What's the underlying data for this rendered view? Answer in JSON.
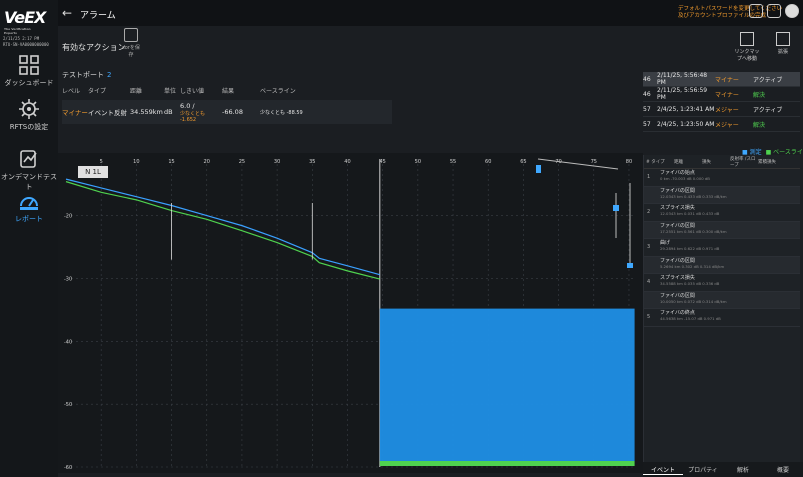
{
  "brand": {
    "logo_text": "VeEX",
    "logo_tagline": "The Verification Experts"
  },
  "device": {
    "line1": "2/11/25 2:17 PM",
    "line2": "RTU-SN-VA0000000000"
  },
  "sidebar": {
    "items": [
      {
        "label": "ダッシュボード"
      },
      {
        "label": "RFTSの設定"
      },
      {
        "label": "オンデマンドテスト"
      },
      {
        "label": "レポート"
      }
    ]
  },
  "header": {
    "title": "アラーム",
    "warning": "デフォルトパスワードを変更してください 及びアカウントプロファイルの完成"
  },
  "actions": {
    "label": "有効なアクション",
    "save_label": "sorを保存",
    "tools": [
      {
        "label": "リンクマップへ移動"
      },
      {
        "label": "拡張"
      }
    ]
  },
  "test_port": {
    "label": "テストポート",
    "number": "2",
    "columns": [
      "レベル",
      "タイプ",
      "距離",
      "単位",
      "しきい値",
      "結果",
      "ベースライン"
    ],
    "row": {
      "level": "マイナー",
      "type": "イベント反射",
      "distance": "34.559km",
      "unit": "dB",
      "threshold_prefix": "6.0 /",
      "threshold_value": "少なくとも -1.652",
      "result": "-66.08",
      "baseline": "少なくとも -88.59"
    }
  },
  "event_list": [
    {
      "id": "46",
      "time": "2/11/25, 5:56:48 PM",
      "level": "マイナー",
      "state": "アクティブ",
      "state_color": "#ffffff"
    },
    {
      "id": "46",
      "time": "2/11/25, 5:56:59 PM",
      "level": "マイナー",
      "state": "解決",
      "state_color": "#4fd24f"
    },
    {
      "id": "57",
      "time": "2/4/25, 1:23:41 AM",
      "level": "メジャー",
      "state": "アクティブ",
      "state_color": "#ffffff"
    },
    {
      "id": "57",
      "time": "2/4/25, 1:23:50 AM",
      "level": "メジャー",
      "state": "解決",
      "state_color": "#4fd24f"
    }
  ],
  "legend": {
    "a": "■ 測定",
    "b": "■ ベースライン"
  },
  "chart": {
    "chip": "N 1L",
    "x_ticks": [
      "5",
      "10",
      "15",
      "20",
      "25",
      "30",
      "35",
      "40",
      "45",
      "50",
      "55",
      "60",
      "65",
      "70",
      "75",
      "80"
    ],
    "y_ticks": [
      "-20",
      "-30",
      "-40",
      "-50",
      "-60"
    ],
    "colors": {
      "measured": "#3aa0ff",
      "baseline": "#4fd24f",
      "noise": "#1f8fe6",
      "grid": "#3a3f46"
    }
  },
  "chart_data": {
    "type": "line",
    "xlim": [
      0,
      81
    ],
    "ylim": [
      -60,
      -11
    ],
    "series": [
      {
        "name": "測定",
        "x": [
          0,
          5,
          10,
          15,
          20,
          25,
          30,
          35,
          36,
          40,
          44.6
        ],
        "y": [
          -14.2,
          -15.6,
          -17.0,
          -18.4,
          -20.0,
          -21.6,
          -23.6,
          -25.9,
          -26.8,
          -28.0,
          -29.4
        ]
      },
      {
        "name": "ベースライン",
        "x": [
          0,
          5,
          10,
          15,
          20,
          25,
          30,
          35,
          36,
          40,
          44.6
        ],
        "y": [
          -14.6,
          -16.3,
          -17.5,
          -19.2,
          -20.6,
          -22.4,
          -24.3,
          -26.5,
          -27.5,
          -28.8,
          -30.1
        ]
      }
    ]
  },
  "event_panel": {
    "headers": [
      "# タイプ",
      "距離",
      "損失",
      "反射率 /スロープ",
      "累積損失"
    ],
    "rows": [
      {
        "n": "1",
        "name": "ファイバの始点",
        "sub": "0 km   -70.003 dB   0.000 dB"
      },
      {
        "n": "",
        "name": "ファイバの区間",
        "sub": "12.0343 km  0.433 dB  0.333 dB/km"
      },
      {
        "n": "2",
        "name": "スプライス損失",
        "sub": "12.0343 km  0.031 dB  0.433 dB"
      },
      {
        "n": "",
        "name": "ファイバの区間",
        "sub": "17.2551 km  0.561 dB  0.300 dB/km"
      },
      {
        "n": "3",
        "name": "曲げ",
        "sub": "29.2894 km  0.622 dB  0.971 dB"
      },
      {
        "n": "",
        "name": "ファイバの区間",
        "sub": "5.2694 km  0.302 dB  0.314 dB/km"
      },
      {
        "n": "4",
        "name": "スプライス損失",
        "sub": "34.5588 km  0.035 dB  0.336 dB"
      },
      {
        "n": "",
        "name": "ファイバの区間",
        "sub": "10.0050 km  0.072 dB  0.314 dB/km"
      },
      {
        "n": "5",
        "name": "ファイバの終点",
        "sub": "44.5638 km  -15.07 dB  0.971 dB"
      }
    ]
  },
  "bottom_tabs": [
    "イベント",
    "プロパティ",
    "解析",
    "概要"
  ]
}
